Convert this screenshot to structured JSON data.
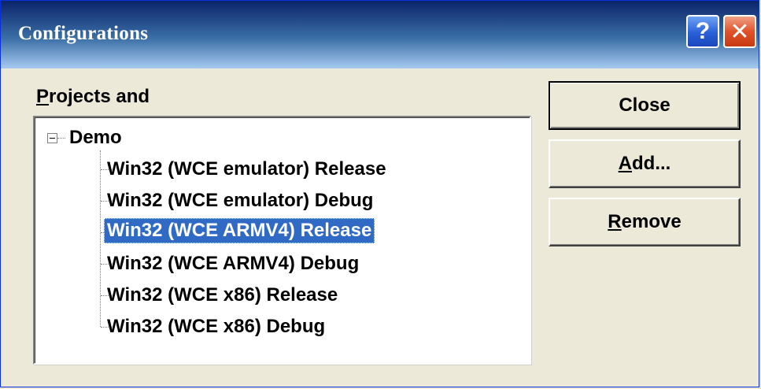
{
  "window": {
    "title": "Configurations",
    "help_glyph": "?",
    "close_glyph": "✕"
  },
  "group": {
    "label_prefix": "",
    "label_accel": "P",
    "label_rest": "rojects and"
  },
  "tree": {
    "root": "Demo",
    "items": [
      {
        "label": "Win32 (WCE emulator) Release",
        "selected": false
      },
      {
        "label": "Win32 (WCE emulator) Debug",
        "selected": false
      },
      {
        "label": "Win32 (WCE ARMV4) Release",
        "selected": true
      },
      {
        "label": "Win32 (WCE ARMV4) Debug",
        "selected": false
      },
      {
        "label": "Win32 (WCE x86) Release",
        "selected": false
      },
      {
        "label": "Win32 (WCE x86) Debug",
        "selected": false
      }
    ]
  },
  "buttons": {
    "close": "Close",
    "add_accel": "A",
    "add_rest": "dd...",
    "remove_accel": "R",
    "remove_rest": "emove"
  },
  "colors": {
    "selection": "#316ac5",
    "dialog_bg": "#ece9d8"
  },
  "icons": {
    "help": "help-icon",
    "close": "close-icon",
    "expander": "tree-collapse-icon"
  }
}
